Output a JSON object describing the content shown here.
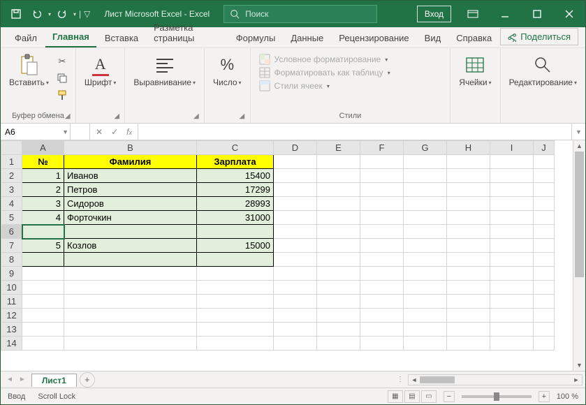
{
  "title": "Лист Microsoft Excel  -  Excel",
  "search": {
    "placeholder": "Поиск"
  },
  "login_label": "Вход",
  "menu": {
    "file": "Файл",
    "home": "Главная",
    "insert": "Вставка",
    "layout": "Разметка страницы",
    "formulas": "Формулы",
    "data": "Данные",
    "review": "Рецензирование",
    "view": "Вид",
    "help": "Справка",
    "share": "Поделиться"
  },
  "ribbon": {
    "paste": "Вставить",
    "clipboard": "Буфер обмена",
    "font": "Шрифт",
    "alignment": "Выравнивание",
    "number": "Число",
    "number_symbol": "%",
    "styles": "Стили",
    "cond_format": "Условное форматирование",
    "format_table": "Форматировать как таблицу",
    "cell_styles": "Стили ячеек",
    "cells": "Ячейки",
    "editing": "Редактирование"
  },
  "name_box": "A6",
  "columns": [
    "A",
    "B",
    "C",
    "D",
    "E",
    "F",
    "G",
    "H",
    "I",
    "J"
  ],
  "headers": {
    "num": "№",
    "surname": "Фамилия",
    "salary": "Зарплата"
  },
  "rows": [
    {
      "n": "1",
      "name": "Иванов",
      "s": "15400"
    },
    {
      "n": "2",
      "name": "Петров",
      "s": "17299"
    },
    {
      "n": "3",
      "name": "Сидоров",
      "s": "28993"
    },
    {
      "n": "4",
      "name": "Форточкин",
      "s": "31000"
    },
    {
      "n": "",
      "name": "",
      "s": ""
    },
    {
      "n": "5",
      "name": "Козлов",
      "s": "15000"
    },
    {
      "n": "",
      "name": "",
      "s": ""
    }
  ],
  "sheet_tab": "Лист1",
  "status": {
    "mode": "Ввод",
    "scroll_lock": "Scroll Lock",
    "zoom": "100 %"
  }
}
